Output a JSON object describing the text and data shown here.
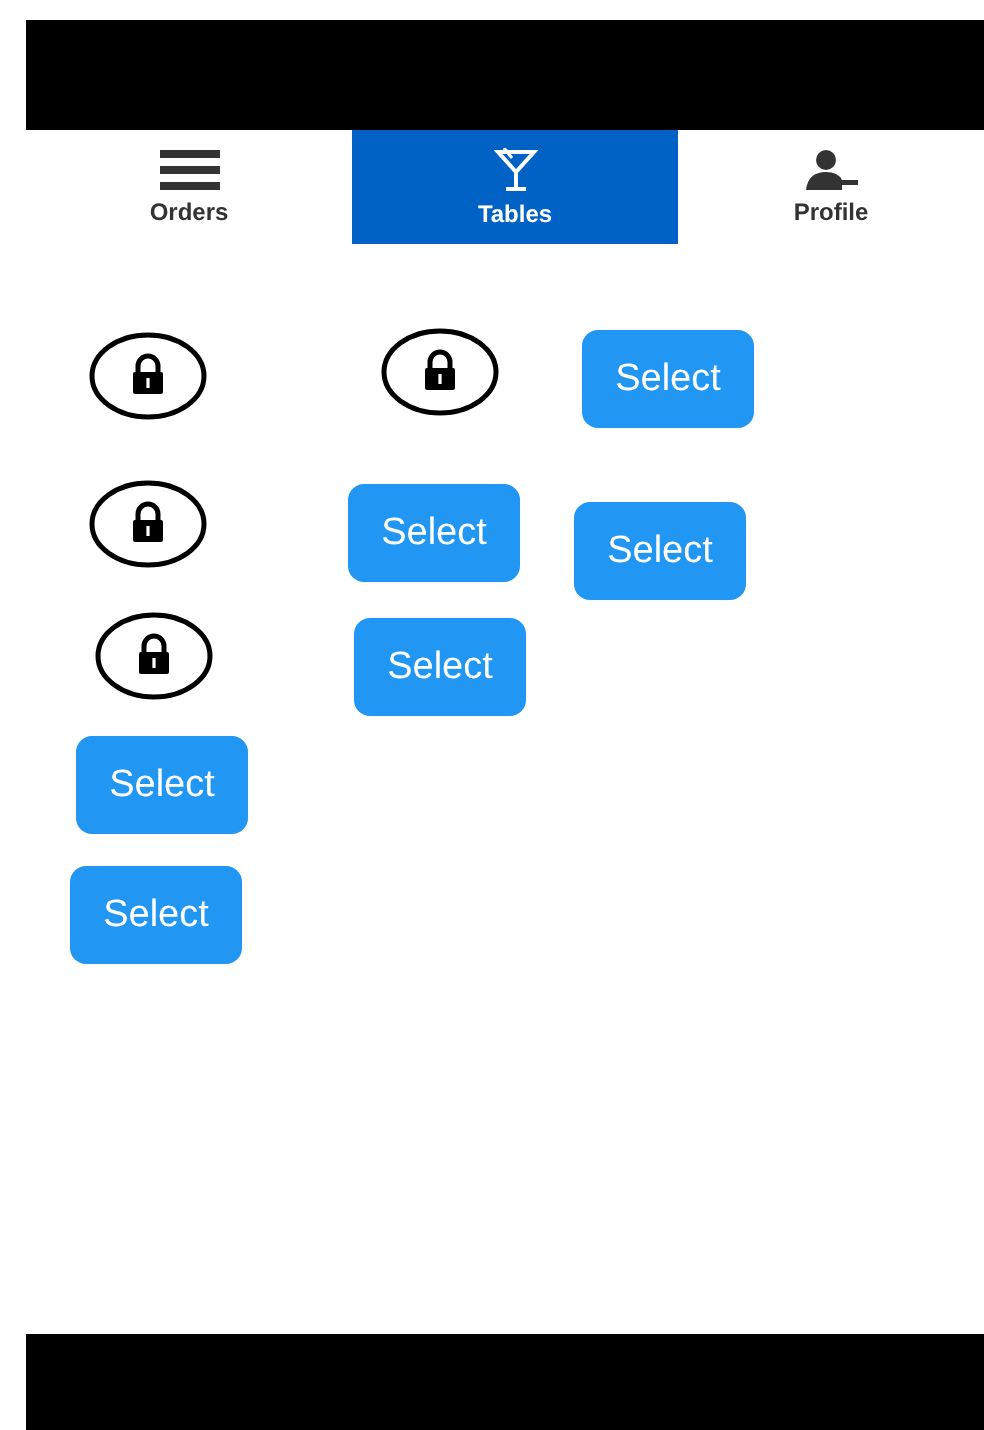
{
  "tabs": [
    {
      "label": "Orders",
      "selected": false
    },
    {
      "label": "Tables",
      "selected": true
    },
    {
      "label": "Profile",
      "selected": false
    }
  ],
  "tables": [
    {
      "kind": "locked"
    },
    {
      "kind": "locked"
    },
    {
      "kind": "available",
      "label": "Select"
    },
    {
      "kind": "locked"
    },
    {
      "kind": "available",
      "label": "Select"
    },
    {
      "kind": "available",
      "label": "Select"
    },
    {
      "kind": "locked"
    },
    {
      "kind": "available",
      "label": "Select"
    },
    {
      "kind": "available",
      "label": "Select"
    },
    {
      "kind": "available",
      "label": "Select"
    }
  ]
}
